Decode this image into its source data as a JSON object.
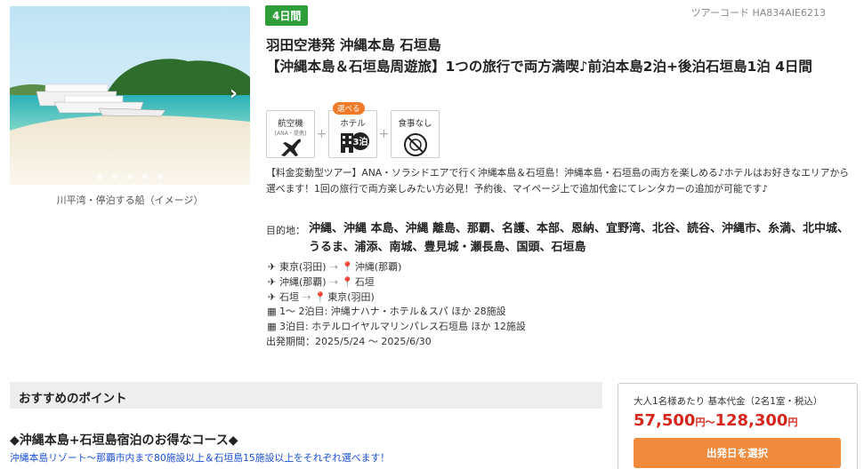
{
  "image": {
    "caption": "川平湾・停泊する船（イメージ）",
    "slide_count": 5,
    "active_slide": 1
  },
  "tour": {
    "days_badge": "4日間",
    "tour_code": "ツアーコード HA834AIE6213",
    "title_line1": "羽田空港発 沖縄本島 石垣島",
    "title_line2": "【沖縄本島＆石垣島周遊旅】1つの旅行で両方満喫♪前泊本島2泊+後泊石垣島1泊 4日間"
  },
  "features": {
    "flight_label": "航空機",
    "flight_sub": "[ANA・提携]",
    "hotel_tag": "選べる",
    "hotel_label": "ホテル",
    "hotel_nights": "3泊",
    "meal_label": "食事なし",
    "plus": "+"
  },
  "description": "【料金変動型ツアー】ANA・ソラシドエアで行く沖縄本島＆石垣島！沖縄本島・石垣島の両方を楽しめる♪ホテルはお好きなエリアから選べます！1回の旅行で両方楽しみたい方必見！予約後、マイページ上で追加代金にてレンタカーの追加が可能です♪",
  "destination": {
    "label": "目的地：",
    "value": "沖縄、沖縄 本島、沖縄 離島、那覇、名護、本部、恩納、宜野湾、北谷、読谷、沖縄市、糸満、北中城、うるま、浦添、南城、豊見城・瀬長島、国頭、石垣島"
  },
  "routes": [
    {
      "from": "東京(羽田)",
      "to": "沖縄(那覇)"
    },
    {
      "from": "沖縄(那覇)",
      "to": "石垣"
    },
    {
      "from": "石垣",
      "to": "東京(羽田)"
    }
  ],
  "route_arrow": "⇢",
  "hotels": [
    "1〜 2泊目: 沖縄ナハナ・ホテル＆スパ ほか 28施設",
    "3泊目: ホテルロイヤルマリンパレス石垣島 ほか 12施設"
  ],
  "period": "出発期間：2025/5/24 〜 2025/6/30",
  "recommend": {
    "header": "おすすめのポイント",
    "title": "◆沖縄本島+石垣島宿泊のお得なコース◆",
    "text": "沖縄本島リゾート〜那覇市内まで80施設以上＆石垣島15施設以上をそれぞれ選べます！"
  },
  "price": {
    "note": "大人1名様あたり 基本代金（2名1室・税込）",
    "min": "57,500",
    "max": "128,300",
    "unit": "円",
    "sep": "〜",
    "button": "出発日を選択"
  }
}
